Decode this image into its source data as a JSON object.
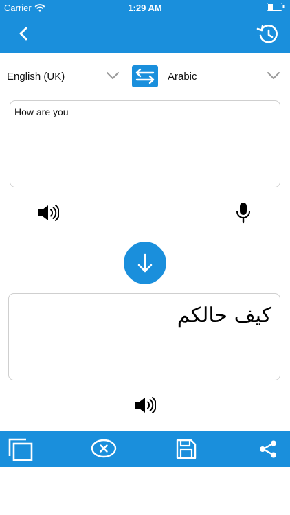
{
  "status_bar": {
    "carrier": "Carrier",
    "time": "1:29 AM"
  },
  "nav": {
    "back_icon": "chevron-left-icon",
    "history_icon": "history-icon"
  },
  "languages": {
    "source": "English (UK)",
    "target": "Arabic"
  },
  "input": {
    "text": "How are you"
  },
  "output": {
    "text": "كيف حالكم"
  },
  "bottom_bar": [
    "copy-icon",
    "clear-icon",
    "save-icon",
    "share-icon"
  ],
  "colors": {
    "accent": "#1a8fdc",
    "border": "#cfcfcf"
  }
}
